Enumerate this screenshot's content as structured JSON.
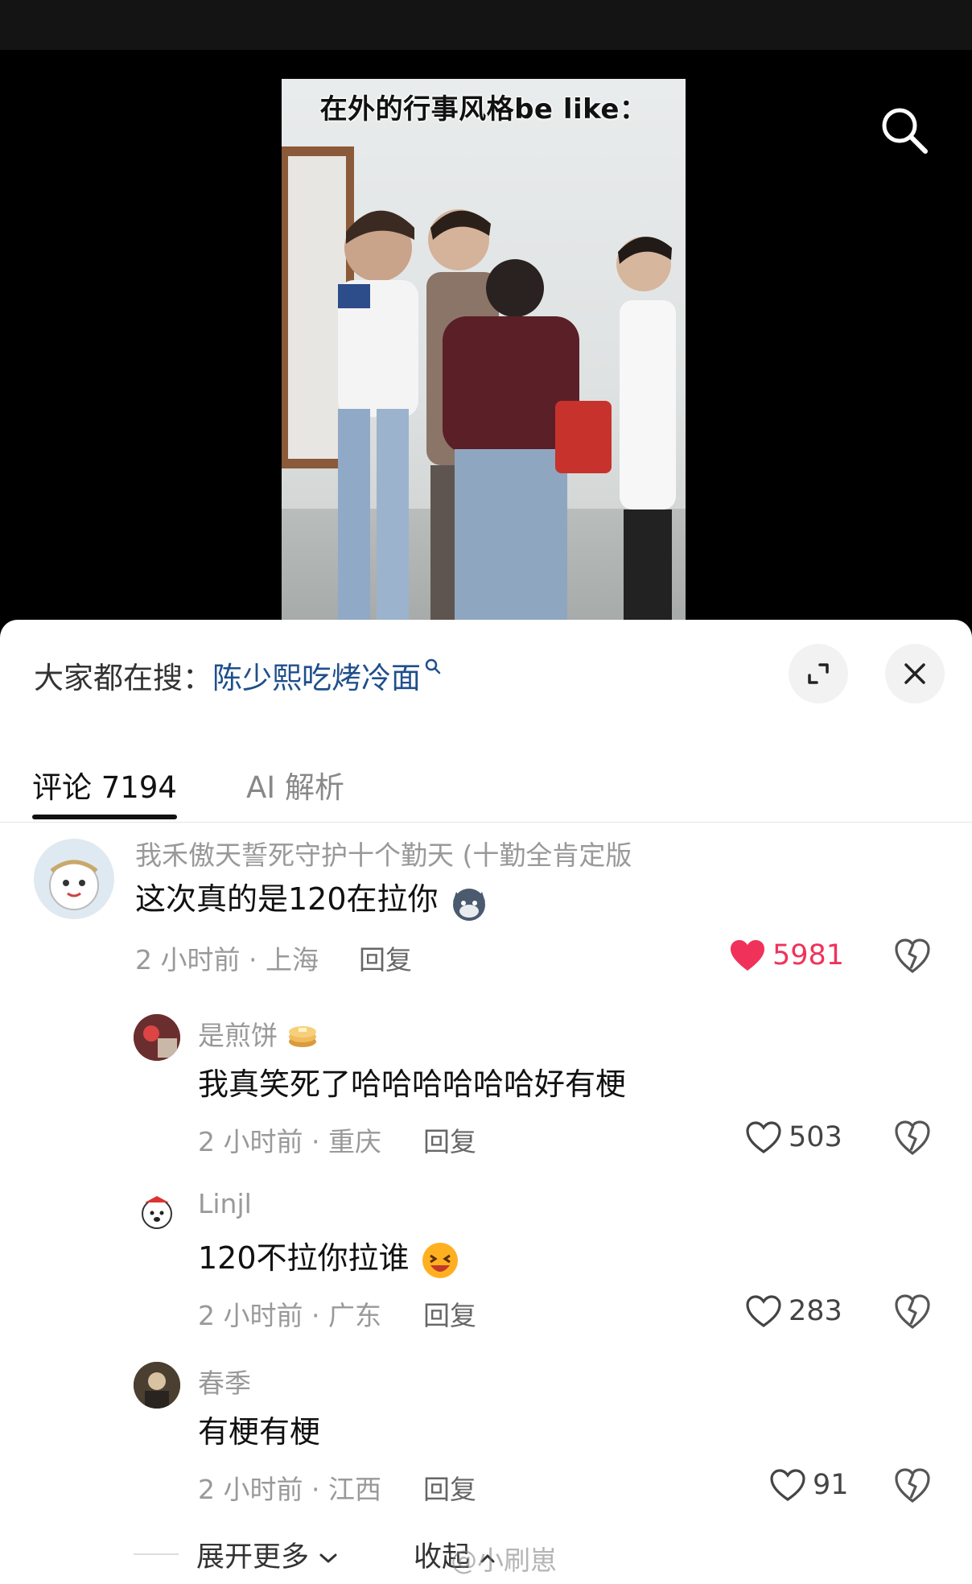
{
  "video": {
    "caption": "在外的行事风格be like："
  },
  "sheet": {
    "trend_prefix": "大家都在搜：",
    "trend_term": "陈少熙吃烤冷面",
    "tabs": [
      {
        "label": "评论 7194",
        "active": true
      },
      {
        "label": "AI 解析",
        "active": false
      }
    ]
  },
  "comments": [
    {
      "username": "我禾傲天誓死守护十个勤天 (十勤全肯定版",
      "text": "这次真的是120在拉你",
      "time": "2 小时前 · 上海",
      "reply": "回复",
      "likes": "5981",
      "liked": true
    },
    {
      "username": "是煎饼",
      "text": "我真笑死了哈哈哈哈哈哈好有梗",
      "time": "2 小时前 · 重庆",
      "reply": "回复",
      "likes": "503",
      "liked": false
    },
    {
      "username": "Linjl",
      "text": "120不拉你拉谁",
      "time": "2 小时前 · 广东",
      "reply": "回复",
      "likes": "283",
      "liked": false
    },
    {
      "username": "春季",
      "text": "有梗有梗",
      "time": "2 小时前 · 江西",
      "reply": "回复",
      "likes": "91",
      "liked": false
    }
  ],
  "footer": {
    "expand_more": "展开更多",
    "collapse": "收起",
    "watermark": "@小刷崽"
  },
  "colors": {
    "like_active": "#f0325a",
    "trend_link": "#1f4f8c"
  }
}
